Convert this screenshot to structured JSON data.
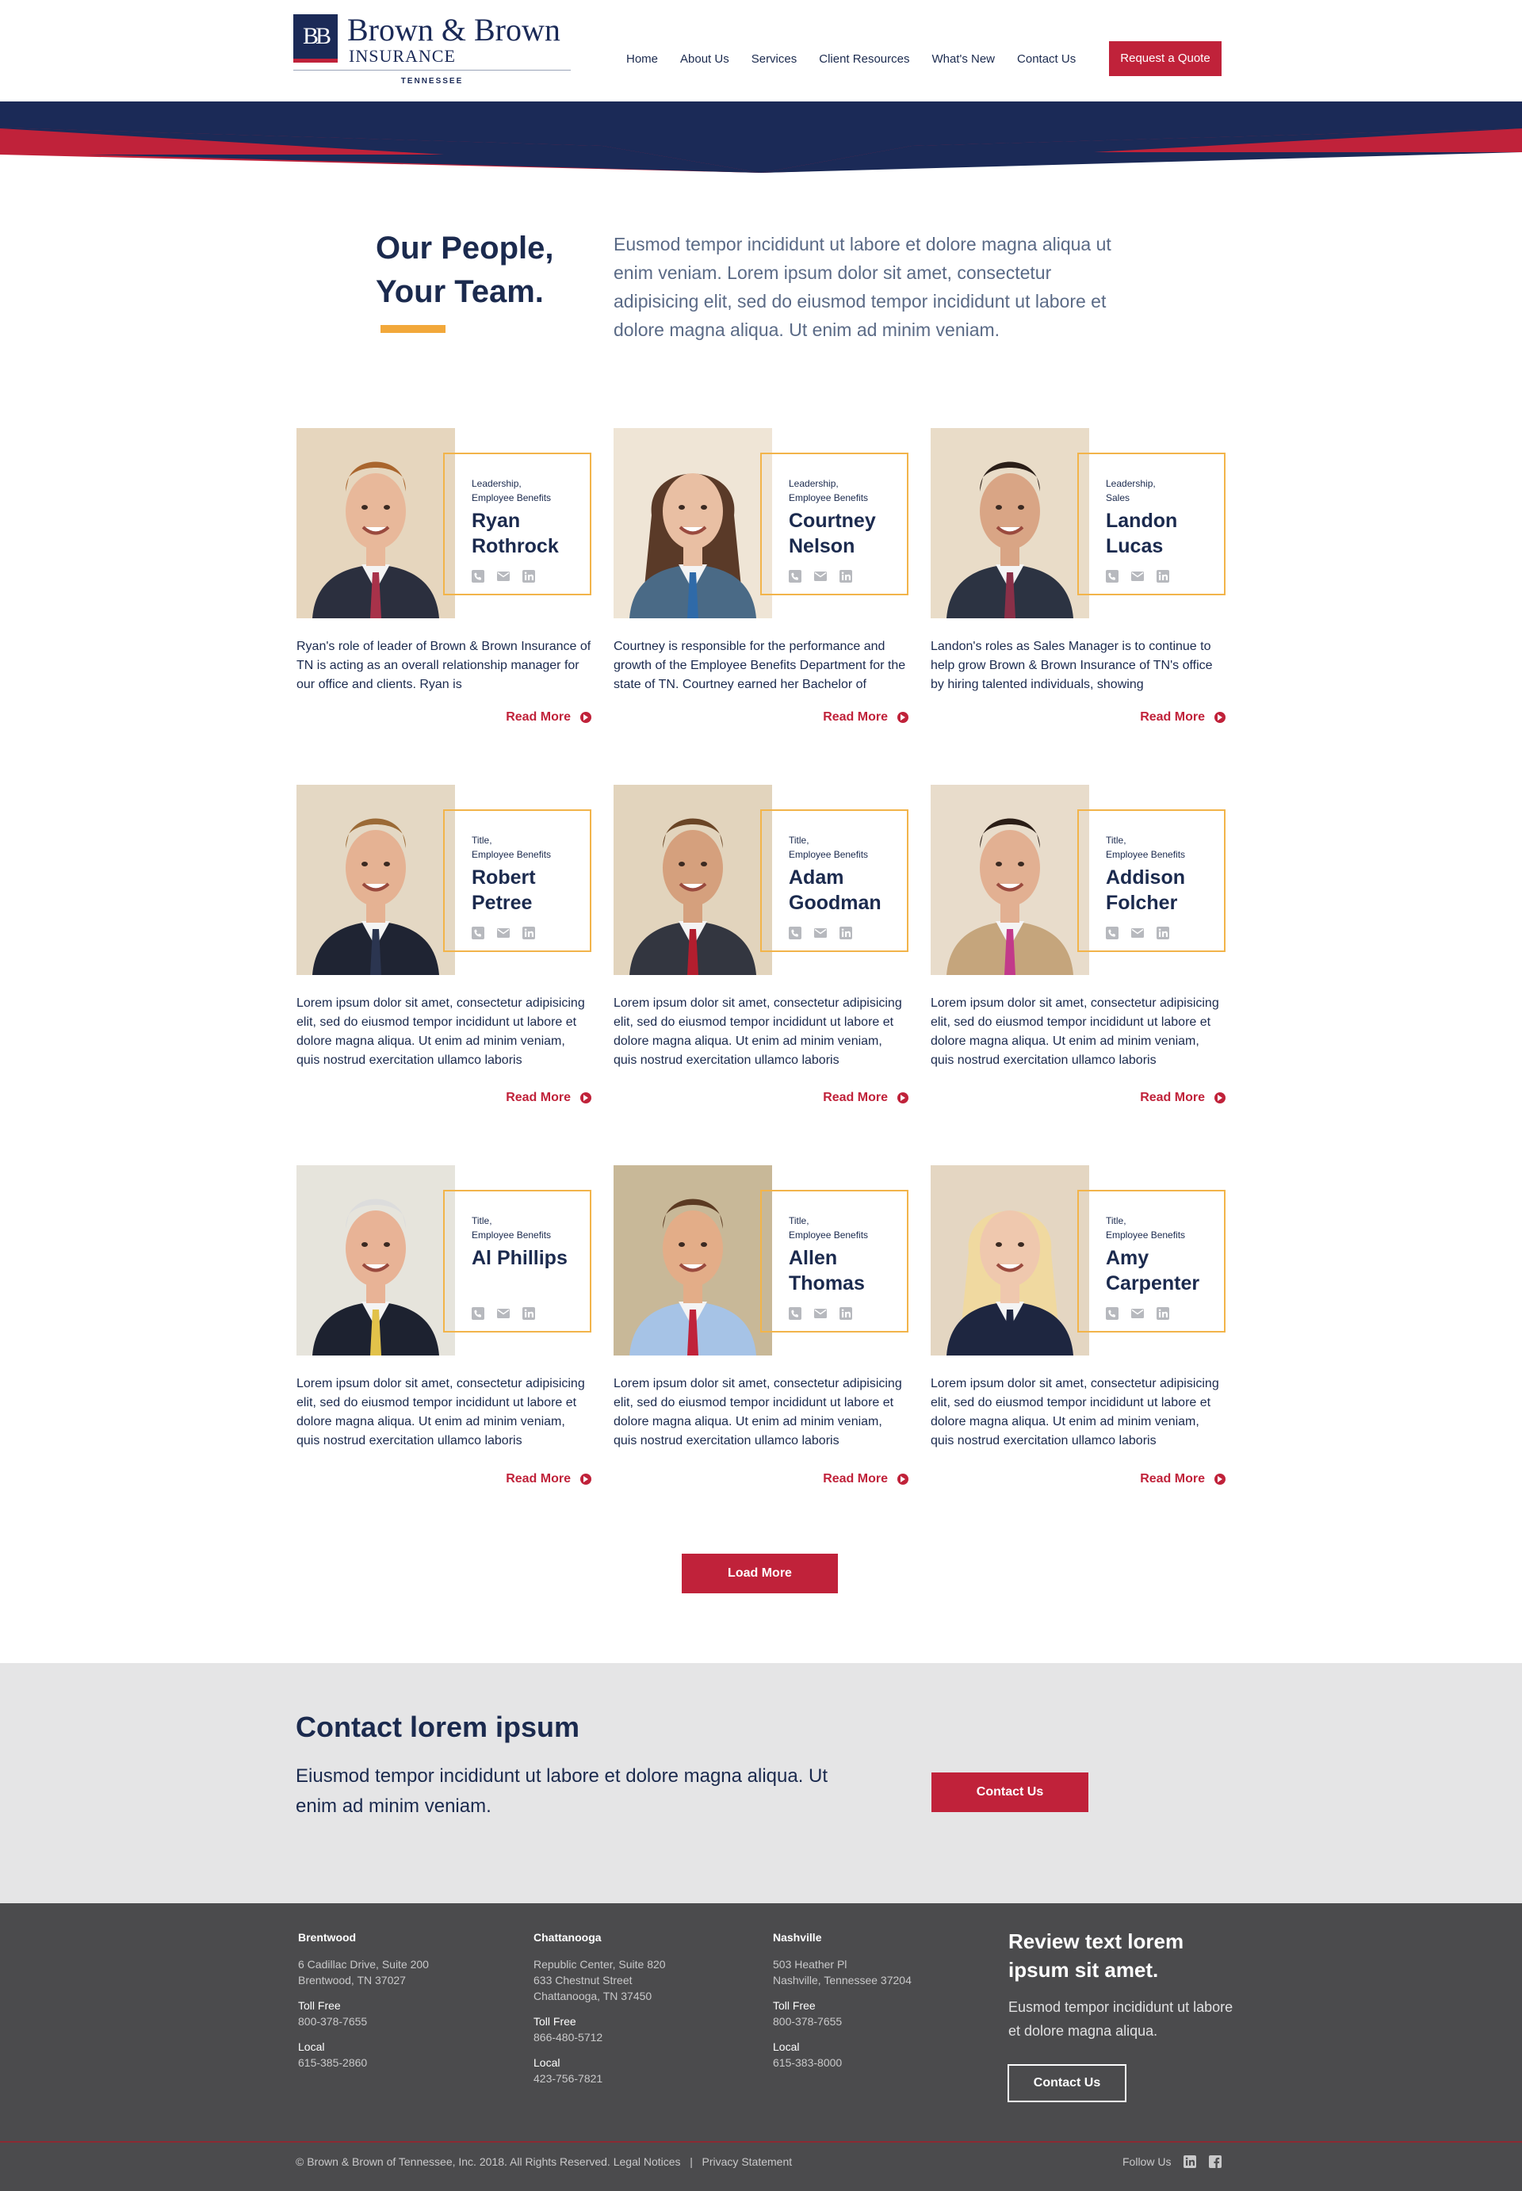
{
  "brand": {
    "monogram": "BB",
    "name": "Brown & Brown",
    "subname": "INSURANCE",
    "state": "TENNESSEE",
    "colors": {
      "navy": "#1b2a57",
      "red": "#c0223a",
      "gold": "#f2b44a"
    }
  },
  "nav": {
    "items": [
      "Home",
      "About Us",
      "Services",
      "Client Resources",
      "What's New",
      "Contact Us"
    ],
    "cta": "Request a Quote"
  },
  "intro": {
    "title_line1": "Our People,",
    "title_line2": "Your Team.",
    "text": "Eusmod tempor incididunt ut labore et dolore magna aliqua ut enim veniam. Lorem ipsum dolor sit amet, consectetur adipisicing elit, sed do eiusmod tempor incididunt ut labore et dolore magna aliqua. Ut enim ad minim veniam."
  },
  "team": [
    {
      "role_line1": "Leadership,",
      "role_line2": "Employee Benefits",
      "first": "Ryan",
      "last": "Rothrock",
      "bio": "Ryan's role of leader of Brown & Brown Insurance of TN is acting as an overall relationship manager for our office and clients. Ryan is",
      "read_more": "Read More",
      "icons": [
        "phone-icon",
        "mail-icon",
        "linkedin-icon"
      ]
    },
    {
      "role_line1": "Leadership,",
      "role_line2": "Employee Benefits",
      "first": "Courtney",
      "last": "Nelson",
      "bio": "Courtney is responsible for the performance and growth of the Employee Benefits Department for the state of TN. Courtney earned her Bachelor of",
      "read_more": "Read More",
      "icons": [
        "phone-icon",
        "mail-icon",
        "linkedin-icon"
      ]
    },
    {
      "role_line1": "Leadership,",
      "role_line2": "Sales",
      "first": "Landon",
      "last": "Lucas",
      "bio": "Landon's roles as Sales Manager is to continue to help grow Brown & Brown Insurance of TN's office by hiring talented individuals, showing",
      "read_more": "Read More",
      "icons": [
        "phone-icon",
        "mail-icon",
        "linkedin-icon"
      ]
    },
    {
      "role_line1": "Title,",
      "role_line2": "Employee Benefits",
      "first": "Robert",
      "last": "Petree",
      "bio": "Lorem ipsum dolor sit amet, consectetur adipisicing elit, sed do eiusmod tempor incididunt ut labore et dolore magna aliqua. Ut enim ad minim veniam, quis nostrud exercitation ullamco laboris",
      "read_more": "Read More",
      "icons": [
        "phone-icon",
        "mail-icon",
        "linkedin-icon"
      ]
    },
    {
      "role_line1": "Title,",
      "role_line2": "Employee Benefits",
      "first": "Adam",
      "last": "Goodman",
      "bio": "Lorem ipsum dolor sit amet, consectetur adipisicing elit, sed do eiusmod tempor incididunt ut labore et dolore magna aliqua. Ut enim ad minim veniam, quis nostrud exercitation ullamco laboris",
      "read_more": "Read More",
      "icons": [
        "phone-icon",
        "mail-icon",
        "linkedin-icon"
      ]
    },
    {
      "role_line1": "Title,",
      "role_line2": "Employee Benefits",
      "first": "Addison",
      "last": "Folcher",
      "bio": "Lorem ipsum dolor sit amet, consectetur adipisicing elit, sed do eiusmod tempor incididunt ut labore et dolore magna aliqua. Ut enim ad minim veniam, quis nostrud exercitation ullamco laboris",
      "read_more": "Read More",
      "icons": [
        "phone-icon",
        "mail-icon",
        "linkedin-icon"
      ]
    },
    {
      "role_line1": "Title,",
      "role_line2": "Employee Benefits",
      "first": "Al Phillips",
      "last": "",
      "bio": "Lorem ipsum dolor sit amet, consectetur adipisicing elit, sed do eiusmod tempor incididunt ut labore et dolore magna aliqua. Ut enim ad minim veniam, quis nostrud exercitation ullamco laboris",
      "read_more": "Read More",
      "icons": [
        "phone-icon",
        "mail-icon",
        "linkedin-icon"
      ]
    },
    {
      "role_line1": "Title,",
      "role_line2": "Employee Benefits",
      "first": "Allen",
      "last": "Thomas",
      "bio": "Lorem ipsum dolor sit amet, consectetur adipisicing elit, sed do eiusmod tempor incididunt ut labore et dolore magna aliqua. Ut enim ad minim veniam, quis nostrud exercitation ullamco laboris",
      "read_more": "Read More",
      "icons": [
        "phone-icon",
        "mail-icon",
        "linkedin-icon"
      ]
    },
    {
      "role_line1": "Title,",
      "role_line2": "Employee Benefits",
      "first": "Amy",
      "last": "Carpenter",
      "bio": "Lorem ipsum dolor sit amet, consectetur adipisicing elit, sed do eiusmod tempor incididunt ut labore et dolore magna aliqua. Ut enim ad minim veniam, quis nostrud exercitation ullamco laboris",
      "read_more": "Read More",
      "icons": [
        "phone-icon",
        "mail-icon",
        "linkedin-icon"
      ]
    }
  ],
  "load_more": "Load More",
  "contact": {
    "title": "Contact lorem ipsum",
    "text": "Eiusmod tempor incididunt ut labore et dolore magna aliqua. Ut enim ad minim veniam.",
    "button": "Contact Us"
  },
  "footer": {
    "offices": [
      {
        "city": "Brentwood",
        "address": [
          "6 Cadillac Drive, Suite 200",
          "Brentwood, TN 37027"
        ],
        "toll_free_label": "Toll Free",
        "toll_free": "800-378-7655",
        "local_label": "Local",
        "local": "615-385-2860"
      },
      {
        "city": "Chattanooga",
        "address": [
          "Republic Center, Suite 820",
          "633 Chestnut Street",
          "Chattanooga, TN 37450"
        ],
        "toll_free_label": "Toll Free",
        "toll_free": "866-480-5712",
        "local_label": "Local",
        "local": "423-756-7821"
      },
      {
        "city": "Nashville",
        "address": [
          "503 Heather Pl",
          "Nashville, Tennessee 37204"
        ],
        "toll_free_label": "Toll Free",
        "toll_free": "800-378-7655",
        "local_label": "Local",
        "local": "615-383-8000"
      }
    ],
    "review_title": "Review text lorem ipsum sit amet.",
    "review_text": "Eusmod tempor incididunt ut labore et dolore magna aliqua.",
    "review_button": "Contact Us",
    "copyright": "© Brown & Brown of Tennessee, Inc. 2018. All Rights Reserved.",
    "legal": "Legal Notices",
    "separator": "|",
    "privacy": "Privacy Statement",
    "follow": "Follow Us",
    "social_icons": [
      "linkedin-icon",
      "facebook-icon"
    ]
  }
}
